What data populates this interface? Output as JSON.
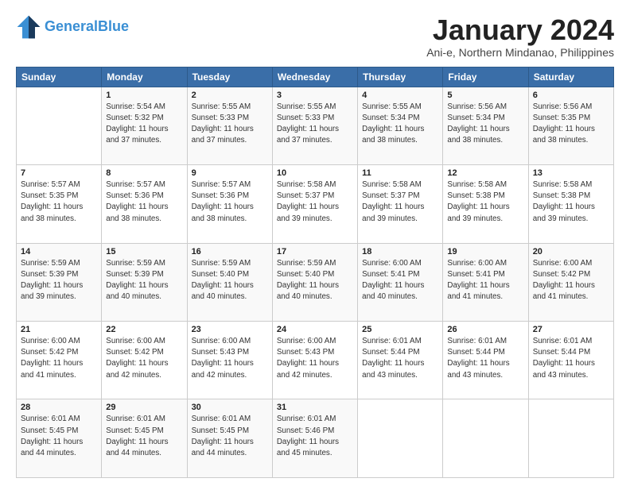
{
  "header": {
    "logo_line1": "General",
    "logo_line2": "Blue",
    "month_title": "January 2024",
    "location": "Ani-e, Northern Mindanao, Philippines"
  },
  "days_of_week": [
    "Sunday",
    "Monday",
    "Tuesday",
    "Wednesday",
    "Thursday",
    "Friday",
    "Saturday"
  ],
  "weeks": [
    [
      {
        "day": "",
        "info": ""
      },
      {
        "day": "1",
        "info": "Sunrise: 5:54 AM\nSunset: 5:32 PM\nDaylight: 11 hours\nand 37 minutes."
      },
      {
        "day": "2",
        "info": "Sunrise: 5:55 AM\nSunset: 5:33 PM\nDaylight: 11 hours\nand 37 minutes."
      },
      {
        "day": "3",
        "info": "Sunrise: 5:55 AM\nSunset: 5:33 PM\nDaylight: 11 hours\nand 37 minutes."
      },
      {
        "day": "4",
        "info": "Sunrise: 5:55 AM\nSunset: 5:34 PM\nDaylight: 11 hours\nand 38 minutes."
      },
      {
        "day": "5",
        "info": "Sunrise: 5:56 AM\nSunset: 5:34 PM\nDaylight: 11 hours\nand 38 minutes."
      },
      {
        "day": "6",
        "info": "Sunrise: 5:56 AM\nSunset: 5:35 PM\nDaylight: 11 hours\nand 38 minutes."
      }
    ],
    [
      {
        "day": "7",
        "info": "Sunrise: 5:57 AM\nSunset: 5:35 PM\nDaylight: 11 hours\nand 38 minutes."
      },
      {
        "day": "8",
        "info": "Sunrise: 5:57 AM\nSunset: 5:36 PM\nDaylight: 11 hours\nand 38 minutes."
      },
      {
        "day": "9",
        "info": "Sunrise: 5:57 AM\nSunset: 5:36 PM\nDaylight: 11 hours\nand 38 minutes."
      },
      {
        "day": "10",
        "info": "Sunrise: 5:58 AM\nSunset: 5:37 PM\nDaylight: 11 hours\nand 39 minutes."
      },
      {
        "day": "11",
        "info": "Sunrise: 5:58 AM\nSunset: 5:37 PM\nDaylight: 11 hours\nand 39 minutes."
      },
      {
        "day": "12",
        "info": "Sunrise: 5:58 AM\nSunset: 5:38 PM\nDaylight: 11 hours\nand 39 minutes."
      },
      {
        "day": "13",
        "info": "Sunrise: 5:58 AM\nSunset: 5:38 PM\nDaylight: 11 hours\nand 39 minutes."
      }
    ],
    [
      {
        "day": "14",
        "info": "Sunrise: 5:59 AM\nSunset: 5:39 PM\nDaylight: 11 hours\nand 39 minutes."
      },
      {
        "day": "15",
        "info": "Sunrise: 5:59 AM\nSunset: 5:39 PM\nDaylight: 11 hours\nand 40 minutes."
      },
      {
        "day": "16",
        "info": "Sunrise: 5:59 AM\nSunset: 5:40 PM\nDaylight: 11 hours\nand 40 minutes."
      },
      {
        "day": "17",
        "info": "Sunrise: 5:59 AM\nSunset: 5:40 PM\nDaylight: 11 hours\nand 40 minutes."
      },
      {
        "day": "18",
        "info": "Sunrise: 6:00 AM\nSunset: 5:41 PM\nDaylight: 11 hours\nand 40 minutes."
      },
      {
        "day": "19",
        "info": "Sunrise: 6:00 AM\nSunset: 5:41 PM\nDaylight: 11 hours\nand 41 minutes."
      },
      {
        "day": "20",
        "info": "Sunrise: 6:00 AM\nSunset: 5:42 PM\nDaylight: 11 hours\nand 41 minutes."
      }
    ],
    [
      {
        "day": "21",
        "info": "Sunrise: 6:00 AM\nSunset: 5:42 PM\nDaylight: 11 hours\nand 41 minutes."
      },
      {
        "day": "22",
        "info": "Sunrise: 6:00 AM\nSunset: 5:42 PM\nDaylight: 11 hours\nand 42 minutes."
      },
      {
        "day": "23",
        "info": "Sunrise: 6:00 AM\nSunset: 5:43 PM\nDaylight: 11 hours\nand 42 minutes."
      },
      {
        "day": "24",
        "info": "Sunrise: 6:00 AM\nSunset: 5:43 PM\nDaylight: 11 hours\nand 42 minutes."
      },
      {
        "day": "25",
        "info": "Sunrise: 6:01 AM\nSunset: 5:44 PM\nDaylight: 11 hours\nand 43 minutes."
      },
      {
        "day": "26",
        "info": "Sunrise: 6:01 AM\nSunset: 5:44 PM\nDaylight: 11 hours\nand 43 minutes."
      },
      {
        "day": "27",
        "info": "Sunrise: 6:01 AM\nSunset: 5:44 PM\nDaylight: 11 hours\nand 43 minutes."
      }
    ],
    [
      {
        "day": "28",
        "info": "Sunrise: 6:01 AM\nSunset: 5:45 PM\nDaylight: 11 hours\nand 44 minutes."
      },
      {
        "day": "29",
        "info": "Sunrise: 6:01 AM\nSunset: 5:45 PM\nDaylight: 11 hours\nand 44 minutes."
      },
      {
        "day": "30",
        "info": "Sunrise: 6:01 AM\nSunset: 5:45 PM\nDaylight: 11 hours\nand 44 minutes."
      },
      {
        "day": "31",
        "info": "Sunrise: 6:01 AM\nSunset: 5:46 PM\nDaylight: 11 hours\nand 45 minutes."
      },
      {
        "day": "",
        "info": ""
      },
      {
        "day": "",
        "info": ""
      },
      {
        "day": "",
        "info": ""
      }
    ]
  ]
}
